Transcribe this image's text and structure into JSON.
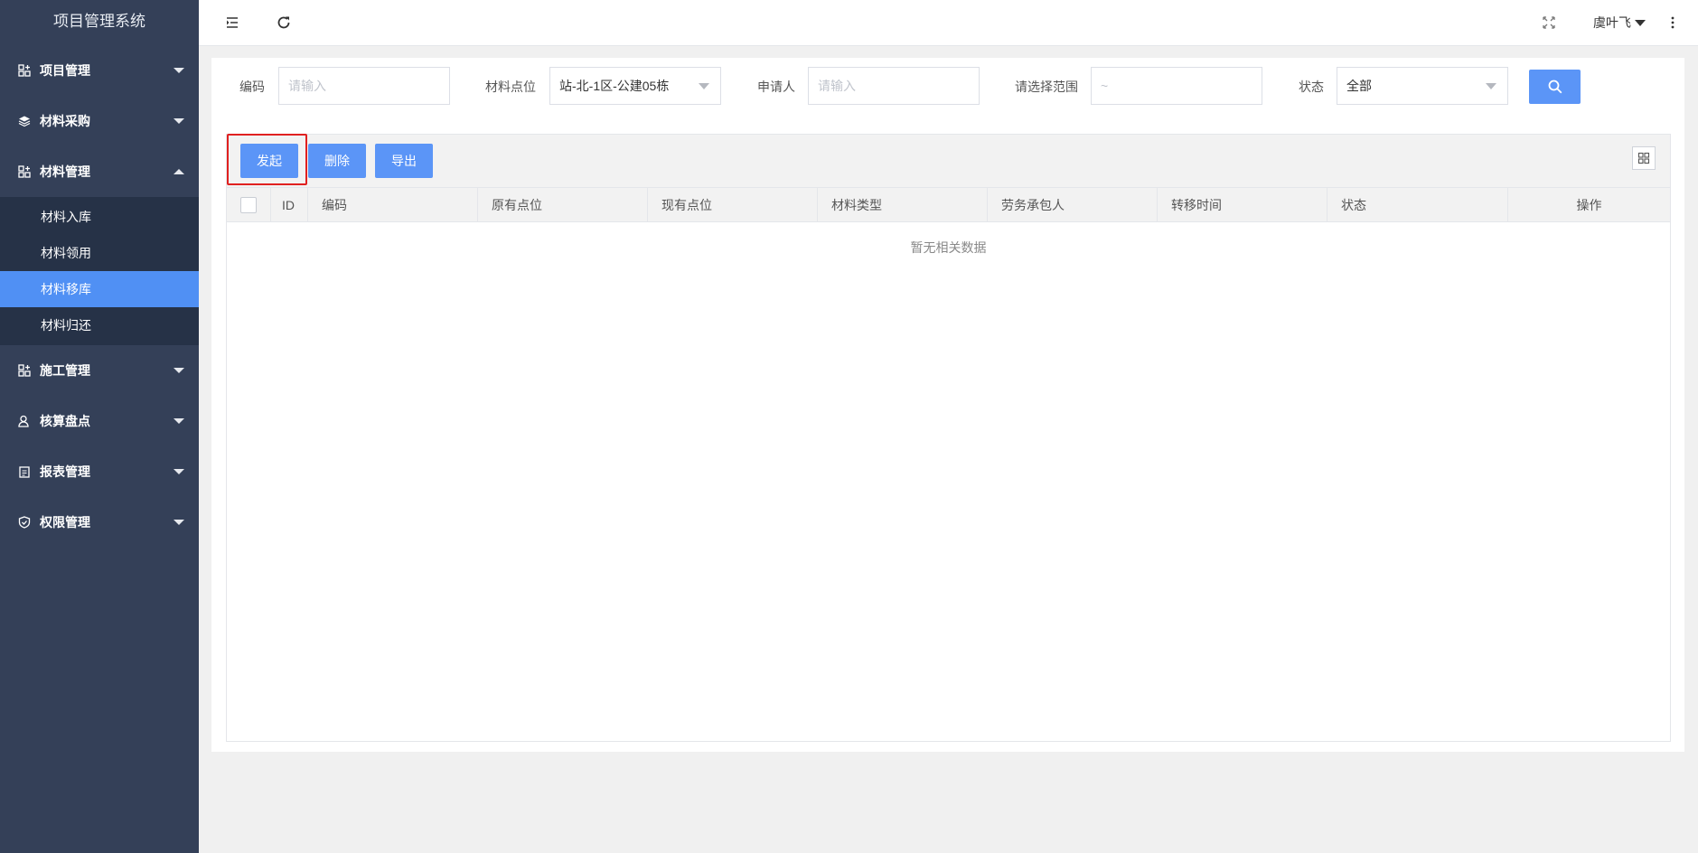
{
  "sidebar": {
    "brand": "项目管理系统",
    "items": [
      {
        "label": "项目管理",
        "icon": "grid-plus-icon"
      },
      {
        "label": "材料采购",
        "icon": "layers-icon"
      },
      {
        "label": "材料管理",
        "icon": "grid-plus-icon",
        "expanded": true,
        "children": [
          {
            "label": "材料入库"
          },
          {
            "label": "材料领用"
          },
          {
            "label": "材料移库",
            "active": true
          },
          {
            "label": "材料归还"
          }
        ]
      },
      {
        "label": "施工管理",
        "icon": "grid-plus-icon"
      },
      {
        "label": "核算盘点",
        "icon": "user-icon"
      },
      {
        "label": "报表管理",
        "icon": "clipboard-icon"
      },
      {
        "label": "权限管理",
        "icon": "shield-check-icon"
      }
    ]
  },
  "header": {
    "menu_icon": "menu-indent-icon",
    "refresh_icon": "refresh-icon",
    "fullscreen_icon": "fullscreen-icon",
    "user_name": "虞叶飞",
    "more_icon": "more-vertical-icon"
  },
  "filters": {
    "code_label": "编码",
    "code_placeholder": "请输入",
    "location_label": "材料点位",
    "location_value": "站-北-1区-公建05栋",
    "applicant_label": "申请人",
    "applicant_placeholder": "请输入",
    "range_label": "请选择范围",
    "range_placeholder": "~",
    "status_label": "状态",
    "status_value": "全部",
    "search_icon": "search-icon"
  },
  "toolbar": {
    "initiate_label": "发起",
    "delete_label": "删除",
    "export_label": "导出",
    "columns_icon": "columns-grid-icon"
  },
  "table": {
    "columns": [
      "ID",
      "编码",
      "原有点位",
      "现有点位",
      "材料类型",
      "劳务承包人",
      "转移时间",
      "状态",
      "操作"
    ],
    "empty_text": "暂无相关数据"
  },
  "colors": {
    "sidebar_bg": "#344058",
    "submenu_bg": "#263247",
    "accent": "#5b95f7",
    "highlight": "#e02020"
  }
}
